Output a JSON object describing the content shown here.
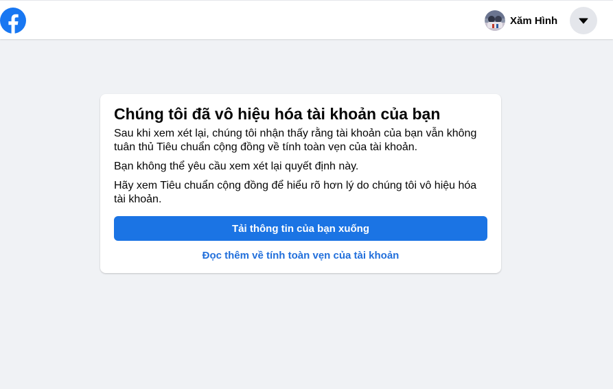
{
  "header": {
    "logo_icon": "facebook-logo-icon",
    "profile_name": "Xăm Hình",
    "avatar_icon": "profile-avatar-icon",
    "menu_icon": "caret-down-icon",
    "brand_color": "#1877f2"
  },
  "notice": {
    "title": "Chúng tôi đã vô hiệu hóa tài khoản của bạn",
    "paragraph_1": "Sau khi xem xét lại, chúng tôi nhận thấy rằng tài khoản của bạn vẫn không tuân thủ Tiêu chuẩn cộng đồng về tính toàn vẹn của tài khoản.",
    "paragraph_2": "Bạn không thể yêu cầu xem xét lại quyết định này.",
    "paragraph_3": "Hãy xem Tiêu chuẩn cộng đồng để hiểu rõ hơn lý do chúng tôi vô hiệu hóa tài khoản.",
    "download_button_label": "Tải thông tin của bạn xuống",
    "learn_more_link": "Đọc thêm về tính toàn vẹn của tài khoản",
    "button_color": "#1b74e4",
    "link_color": "#216fdb"
  }
}
